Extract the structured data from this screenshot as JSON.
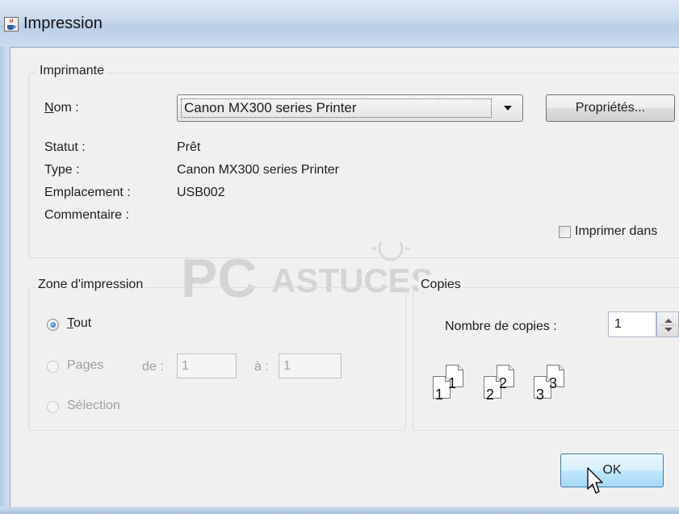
{
  "window": {
    "title": "Impression",
    "icon": "java-cup-icon"
  },
  "printer_group": {
    "legend": "Imprimante",
    "name_label": "Nom :",
    "name_value": "Canon MX300 series Printer",
    "properties_button": "Propriétés...",
    "status_label": "Statut :",
    "status_value": "Prêt",
    "type_label": "Type :",
    "type_value": "Canon MX300 series Printer",
    "location_label": "Emplacement :",
    "location_value": "USB002",
    "comment_label": "Commentaire :",
    "print_to_file_label": "Imprimer dans",
    "print_to_file_checked": false
  },
  "print_range": {
    "legend": "Zone d'impression",
    "all_label": "Tout",
    "pages_label": "Pages",
    "from_label": "de :",
    "from_value": "1",
    "to_label": "à :",
    "to_value": "1",
    "selection_label": "Sélection",
    "selected": "all"
  },
  "copies": {
    "legend": "Copies",
    "count_label": "Nombre de copies :",
    "count_value": "1",
    "collate_pages": [
      "1",
      "2",
      "3"
    ]
  },
  "buttons": {
    "ok": "OK"
  },
  "watermark": "PC ASTUCES",
  "colors": {
    "accent": "#1d5fbf",
    "titlebar": "#c7d8ec",
    "disabled": "#a0a0a0"
  }
}
